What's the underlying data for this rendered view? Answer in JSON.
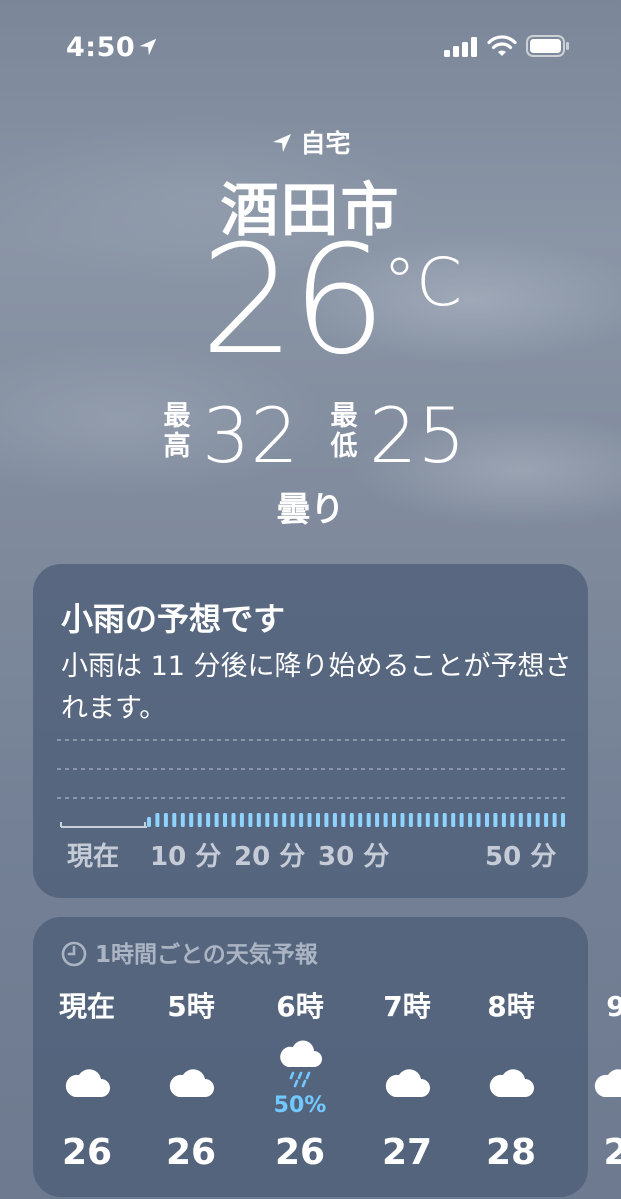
{
  "status_bar": {
    "time": "4:50"
  },
  "header": {
    "location_label": "自宅",
    "city": "酒田市",
    "temperature": "26",
    "unit": "°C",
    "high_label": "最高",
    "high": "32",
    "low_label": "最低",
    "low": "25",
    "condition": "曇り"
  },
  "rain_card": {
    "title": "小雨の予想です",
    "description": "小雨は 11 分後に降り始めることが予想されます。",
    "axis_labels": [
      "現在",
      "10 分",
      "20 分",
      "30 分",
      "50 分"
    ],
    "rain_start_minute": 11,
    "minutes": 60
  },
  "hourly": {
    "header": "1時間ごとの天気予報",
    "hours": [
      {
        "label": "現在",
        "icon": "cloud-icon",
        "precip": "",
        "temp": "26"
      },
      {
        "label": "5時",
        "icon": "cloud-icon",
        "precip": "",
        "temp": "26"
      },
      {
        "label": "6時",
        "icon": "cloud-rain-icon",
        "precip": "50%",
        "temp": "26"
      },
      {
        "label": "7時",
        "icon": "cloud-icon",
        "precip": "",
        "temp": "27"
      },
      {
        "label": "8時",
        "icon": "cloud-icon",
        "precip": "",
        "temp": "28"
      },
      {
        "label": "9",
        "icon": "cloud-icon",
        "precip": "",
        "temp": "2"
      }
    ]
  },
  "colors": {
    "precip_accent": "#72c9ff",
    "rain_bar": "#8fd3ff"
  }
}
